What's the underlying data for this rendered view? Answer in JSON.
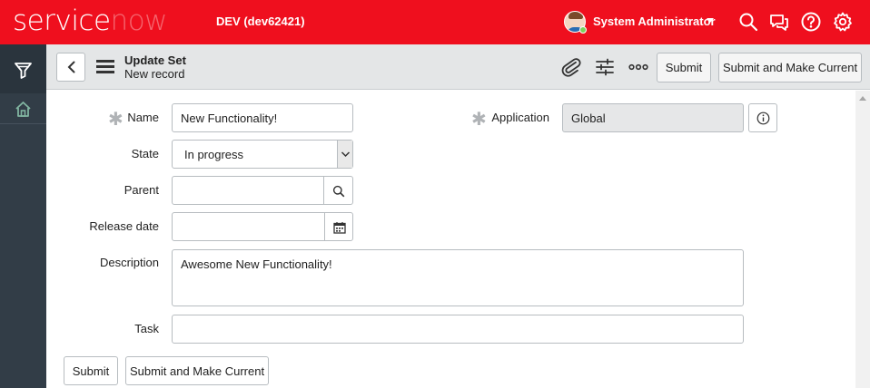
{
  "header": {
    "logo_service": "service",
    "logo_now": "now",
    "instance": "DEV (dev62421)",
    "user_name": "System Administrator",
    "icons": [
      "search-icon",
      "connect-chat-icon",
      "help-icon",
      "settings-gear-icon"
    ],
    "brand_color": "#ef0f1e"
  },
  "leftnav": {
    "items": [
      "filter-navigator-icon",
      "home-icon"
    ],
    "home_color": "#81b5a1"
  },
  "form_header": {
    "title": "Update Set",
    "subtitle": "New record",
    "submit_label": "Submit",
    "submit_make_current_label": "Submit and Make Current"
  },
  "form": {
    "name": {
      "label": "Name",
      "value": "New Functionality!",
      "required": true
    },
    "application": {
      "label": "Application",
      "value": "Global",
      "required": true
    },
    "state": {
      "label": "State",
      "value": "In progress"
    },
    "parent": {
      "label": "Parent",
      "value": ""
    },
    "release_date": {
      "label": "Release date",
      "value": ""
    },
    "description": {
      "label": "Description",
      "value": "Awesome New Functionality!"
    },
    "task": {
      "label": "Task",
      "value": ""
    },
    "required_marker": "✱"
  },
  "footer": {
    "submit_label": "Submit",
    "submit_make_current_label": "Submit and Make Current"
  }
}
